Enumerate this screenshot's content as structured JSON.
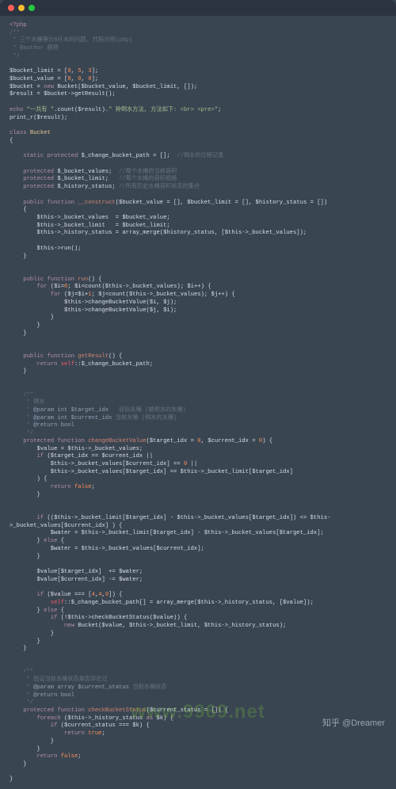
{
  "titlebar": {
    "dots": [
      "red",
      "yellow",
      "green"
    ]
  },
  "watermark": "www.9969.net",
  "attribution": "知乎 @Dreamer",
  "code": {
    "l1": "<?php",
    "l2": "/**",
    "l3": " * 三个水桶等分8升水的问题, 代码示例(php)",
    "l4": " * @author 薛扬",
    "l5": " */",
    "l6": "",
    "l7a": "$bucket_limit = [",
    "l7b": "8",
    "l7c": ", ",
    "l7d": "5",
    "l7e": ", ",
    "l7f": "3",
    "l7g": "];",
    "l8a": "$bucket_value = [",
    "l8b": "8",
    "l8c": ", ",
    "l8d": "0",
    "l8e": ", ",
    "l8f": "0",
    "l8g": "];",
    "l9a": "$bucket = ",
    "l9b": "new",
    "l9c": " Bucket($bucket_value, $bucket_limit, []);",
    "l10": "$result = $bucket->getResult();",
    "l11": "",
    "l12a": "echo ",
    "l12b": "\"一共有 \"",
    "l12c": ".count($result).",
    "l12d": "\" 种倒水方法, 方法如下: <br> <pre>\"",
    "l12e": ";",
    "l13": "print_r($result);",
    "l14": "",
    "l15a": "class",
    "l15b": " Bucket",
    "l16": "{",
    "l17": "",
    "l18a": "    static protected",
    "l18b": " $_change_bucket_path = [];  ",
    "l18c": "//倒水的过程记录",
    "l19": "",
    "l20a": "    protected",
    "l20b": " $_bucket_values;  ",
    "l20c": "//每个水桶的当前容积",
    "l21a": "    protected",
    "l21b": " $_bucket_limit;   ",
    "l21c": "//每个水桶的容积规格",
    "l22a": "    protected",
    "l22b": " $_history_status; ",
    "l22c": "//所有历史水桶容积状态的集合",
    "l23": "",
    "l24a": "    public function",
    "l24b": " __construct",
    "l24c": "($bucket_value = [], $bucket_limit = [], $history_status = [])",
    "l25": "    {",
    "l26": "        $this->_bucket_values  = $bucket_value;",
    "l27": "        $this->_bucket_limit   = $bucket_limit;",
    "l28": "        $this->_history_status = array_merge($history_status, [$this->_bucket_values]);",
    "l29": "",
    "l30": "        $this->run();",
    "l31": "    }",
    "l32": "",
    "l33": "",
    "l34a": "    public function",
    "l34b": " run",
    "l34c": "() {",
    "l35a": "        for",
    "l35b": " ($i=",
    "l35c": "0",
    "l35d": "; $i<count($this->_bucket_values); $i++) {",
    "l36a": "            for",
    "l36b": " ($j=$i+",
    "l36c": "1",
    "l36d": "; $j<count($this->_bucket_values); $j++) {",
    "l37": "                $this->changeBucketValue($i, $j);",
    "l38": "                $this->changeBucketValue($j, $i);",
    "l39": "            }",
    "l40": "        }",
    "l41": "    }",
    "l42": "",
    "l43": "",
    "l44a": "    public function",
    "l44b": " getResult",
    "l44c": "() {",
    "l45a": "        return",
    "l45b": " self",
    "l45c": "::$_change_bucket_path;",
    "l46": "    }",
    "l47": "",
    "l48": "",
    "l49": "    /**",
    "l50": "     * 倒水",
    "l51a": "     * ",
    "l51b": "@param int $target_idx",
    "l51c": "   目标水桶 (被倒水的水桶)",
    "l52a": "     * ",
    "l52b": "@param int $current_idx",
    "l52c": " 当前水桶 (倒水的水桶)",
    "l53a": "     * ",
    "l53b": "@return bool",
    "l54": "     */",
    "l55a": "    protected function",
    "l55b": " changeBucketValue",
    "l55c": "($target_idx = ",
    "l55d": "0",
    "l55e": ", $current_idx = ",
    "l55f": "0",
    "l55g": ") {",
    "l56": "        $value = $this->_bucket_values;",
    "l57a": "        if",
    "l57b": " ($target_idx == $current_idx ||",
    "l58a": "            $this->_bucket_values[$current_idx] == ",
    "l58b": "0",
    "l58c": " ||",
    "l59": "            $this->_bucket_values[$target_idx] == $this->_bucket_limit[$target_idx]",
    "l60": "        ) {",
    "l61a": "            return",
    "l61b": " false",
    "l61c": ";",
    "l62": "        }",
    "l63": "",
    "l64": "",
    "l65a": "        if",
    "l65b": " (($this->_bucket_limit[$target_idx] - $this->_bucket_values[$target_idx]) <= $this-",
    "l66": ">_bucket_values[$current_idx] ) {",
    "l67": "            $water = $this->_bucket_limit[$target_idx] - $this->_bucket_values[$target_idx];",
    "l68a": "        } ",
    "l68b": "else",
    "l68c": " {",
    "l69": "            $water = $this->_bucket_values[$current_idx];",
    "l70": "        }",
    "l71": "",
    "l72": "        $value[$target_idx]  += $water;",
    "l73": "        $value[$current_idx] -= $water;",
    "l74": "",
    "l75a": "        if",
    "l75b": " ($value === [",
    "l75c": "4",
    "l75d": ",",
    "l75e": "4",
    "l75f": ",",
    "l75g": "0",
    "l75h": "]) {",
    "l76a": "            self",
    "l76b": "::$_change_bucket_path[] = array_merge($this->_history_status, [$value]);",
    "l77a": "        } ",
    "l77b": "else",
    "l77c": " {",
    "l78a": "            if",
    "l78b": " (!$this->checkBucketStatus($value)) {",
    "l79a": "                new",
    "l79b": " Bucket($value, $this->_bucket_limit, $this->_history_status);",
    "l80": "            }",
    "l81": "        }",
    "l82": "    }",
    "l83": "",
    "l84": "",
    "l85": "    /**",
    "l86": "     * 验证当前水桶状态是否存在过",
    "l87a": "     * ",
    "l87b": "@param array $current_status",
    "l87c": " 当前水桶状态",
    "l88a": "     * ",
    "l88b": "@return bool",
    "l89": "     */",
    "l90a": "    protected function",
    "l90b": " checkBucketStatus",
    "l90c": "($current_status = []) {",
    "l91a": "        foreach",
    "l91b": " ($this->_history_status ",
    "l91c": "as",
    "l91d": " $k) {",
    "l92a": "            if",
    "l92b": " ($current_status === $k) {",
    "l93a": "                return",
    "l93b": " true",
    "l93c": ";",
    "l94": "            }",
    "l95": "        }",
    "l96a": "        return",
    "l96b": " false",
    "l96c": ";",
    "l97": "    }",
    "l98": "",
    "l99": "}"
  }
}
